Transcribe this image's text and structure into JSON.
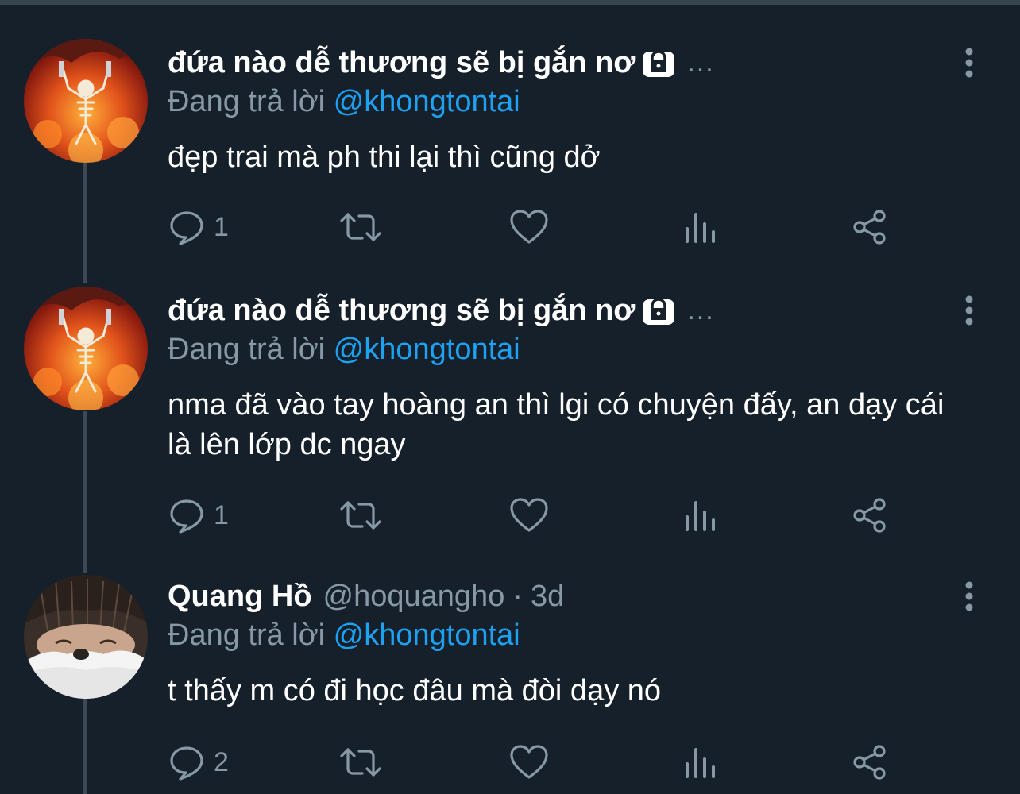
{
  "tweets": [
    {
      "display_name": "đứa nào dễ thương sẽ bị gắn nơ",
      "locked": true,
      "ellipsis": "...",
      "replying_prefix": "Đang trả lời",
      "replying_to": "@khongtontai",
      "text": "đẹp trai mà ph thi lại thì cũng dở",
      "reply_count": "1",
      "avatar": "fire-skeleton-avatar"
    },
    {
      "display_name": "đứa nào dễ thương sẽ bị gắn nơ",
      "locked": true,
      "ellipsis": "...",
      "replying_prefix": "Đang trả lời",
      "replying_to": "@khongtontai",
      "text": "nma đã vào tay hoàng an thì lgi có chuyện đấy, an dạy cái là lên lớp dc ngay",
      "reply_count": "1",
      "avatar": "fire-skeleton-avatar"
    },
    {
      "display_name": "Quang Hồ",
      "handle": "@hoquangho",
      "separator": "·",
      "time": "3d",
      "replying_prefix": "Đang trả lời",
      "replying_to": "@khongtontai",
      "text": "t thấy m có đi học đâu mà đòi dạy nó",
      "reply_count": "2",
      "avatar": "person-photo-avatar"
    }
  ],
  "colors": {
    "background": "#15202b",
    "secondary_text": "#8899a6",
    "link": "#1da1f2",
    "thread_line": "#3d4a56"
  }
}
